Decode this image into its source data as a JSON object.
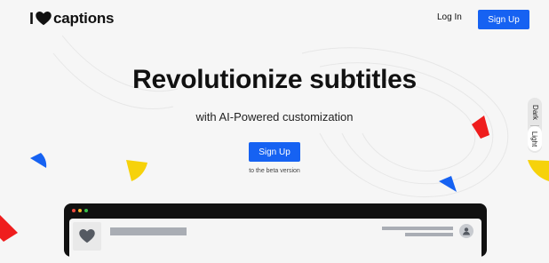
{
  "header": {
    "logo_i": "I",
    "logo_text": "captions",
    "login_label": "Log In",
    "signup_label": "Sign Up"
  },
  "hero": {
    "title": "Revolutionize subtitles",
    "subtitle": "with AI-Powered customization",
    "cta_label": "Sign Up",
    "beta_note": "to the beta version"
  },
  "theme_switch": {
    "options": [
      "Dark",
      "Light"
    ],
    "selected": "Light"
  },
  "colors": {
    "accent": "#1662f2",
    "red": "#ef1d1d",
    "yellow": "#f6d20b",
    "blue": "#1662f2",
    "dark": "#111111"
  },
  "icons": {
    "logo": "heart-icon",
    "mockup_logo": "heart-icon",
    "mockup_avatar": "user-icon"
  }
}
